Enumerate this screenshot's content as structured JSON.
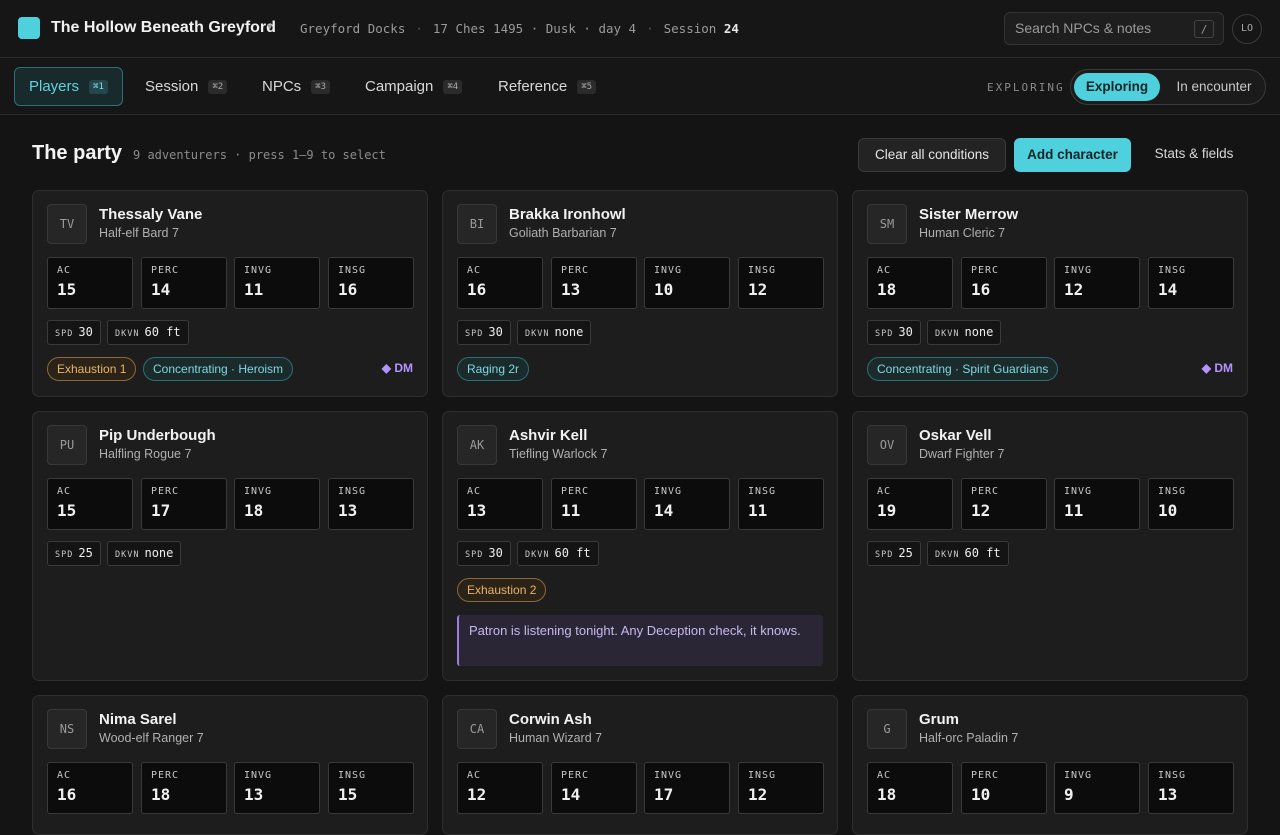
{
  "header": {
    "app_title": "The Hollow Beneath Greyford",
    "location": "Greyford Docks",
    "date_time": "17 Ches 1495 · Dusk · day 4",
    "session_label": "Session",
    "session_number": "24",
    "search_placeholder": "Search NPCs & notes",
    "search_shortcut": "/",
    "user_initials": "LO"
  },
  "nav": {
    "tabs": [
      {
        "label": "Players",
        "shortcut": "⌘1",
        "active": true
      },
      {
        "label": "Session",
        "shortcut": "⌘2"
      },
      {
        "label": "NPCs",
        "shortcut": "⌘3"
      },
      {
        "label": "Campaign",
        "shortcut": "⌘4"
      },
      {
        "label": "Reference",
        "shortcut": "⌘5"
      }
    ],
    "mode_label": "EXPLORING",
    "mode_options": [
      "Exploring",
      "In encounter"
    ],
    "mode_selected": "Exploring"
  },
  "party": {
    "title": "The party",
    "subtitle": "9 adventurers · press 1–9 to select",
    "actions": {
      "clear": "Clear all conditions",
      "add": "Add character",
      "stats": "Stats & fields"
    },
    "stat_labels": [
      "AC",
      "PERC",
      "INVG",
      "INSG"
    ],
    "chip_labels": {
      "speed": "SPD",
      "darkvision": "DKVN"
    },
    "characters": [
      {
        "initials": "TV",
        "name": "Thessaly Vane",
        "class": "Half-elf Bard 7",
        "stats": [
          "15",
          "14",
          "11",
          "16"
        ],
        "speed": "30",
        "darkvision": "60 ft",
        "tags": [
          {
            "text": "Exhaustion 1",
            "kind": "warn"
          },
          {
            "text": "Concentrating · Heroism",
            "kind": "teal"
          }
        ],
        "dm": "◆ DM"
      },
      {
        "initials": "BI",
        "name": "Brakka Ironhowl",
        "class": "Goliath Barbarian 7",
        "stats": [
          "16",
          "13",
          "10",
          "12"
        ],
        "speed": "30",
        "darkvision": "none",
        "tags": [
          {
            "text": "Raging 2r",
            "kind": "teal"
          }
        ]
      },
      {
        "initials": "SM",
        "name": "Sister Merrow",
        "class": "Human Cleric 7",
        "stats": [
          "18",
          "16",
          "12",
          "14"
        ],
        "speed": "30",
        "darkvision": "none",
        "tags": [
          {
            "text": "Concentrating · Spirit Guardians",
            "kind": "teal"
          }
        ],
        "dm": "◆ DM"
      },
      {
        "initials": "PU",
        "name": "Pip Underbough",
        "class": "Halfling Rogue 7",
        "stats": [
          "15",
          "17",
          "18",
          "13"
        ],
        "speed": "25",
        "darkvision": "none",
        "tags": []
      },
      {
        "initials": "AK",
        "name": "Ashvir Kell",
        "class": "Tiefling Warlock 7",
        "stats": [
          "13",
          "11",
          "14",
          "11"
        ],
        "speed": "30",
        "darkvision": "60 ft",
        "tags": [
          {
            "text": "Exhaustion 2",
            "kind": "warn"
          }
        ],
        "note": "Patron is listening tonight. Any Deception check, it knows."
      },
      {
        "initials": "OV",
        "name": "Oskar Vell",
        "class": "Dwarf Fighter 7",
        "stats": [
          "19",
          "12",
          "11",
          "10"
        ],
        "speed": "25",
        "darkvision": "60 ft",
        "tags": []
      },
      {
        "initials": "NS",
        "name": "Nima Sarel",
        "class": "Wood-elf Ranger 7",
        "stats": [
          "16",
          "18",
          "13",
          "15"
        ]
      },
      {
        "initials": "CA",
        "name": "Corwin Ash",
        "class": "Human Wizard 7",
        "stats": [
          "12",
          "14",
          "17",
          "12"
        ]
      },
      {
        "initials": "G",
        "name": "Grum",
        "class": "Half-orc Paladin 7",
        "stats": [
          "18",
          "10",
          "9",
          "13"
        ]
      }
    ]
  }
}
